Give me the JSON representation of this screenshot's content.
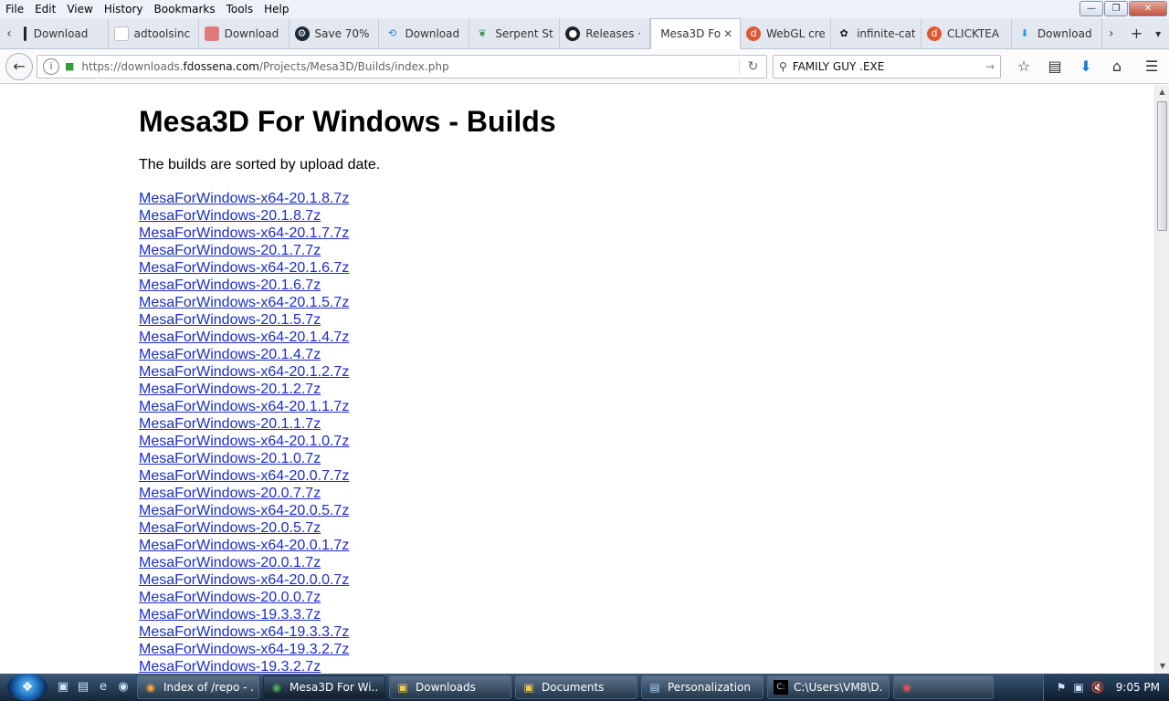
{
  "menubar": {
    "items": [
      "File",
      "Edit",
      "View",
      "History",
      "Bookmarks",
      "Tools",
      "Help"
    ]
  },
  "tabs": [
    {
      "label": "Download",
      "icon": "black-bar-icon"
    },
    {
      "label": "adtoolsinc",
      "icon": "blank-page-icon"
    },
    {
      "label": "Download",
      "icon": "red-box-icon"
    },
    {
      "label": "Save 70% o",
      "icon": "steam-icon"
    },
    {
      "label": "Download",
      "icon": "blue-swirl-icon"
    },
    {
      "label": "Serpent St",
      "icon": "serpent-icon"
    },
    {
      "label": "Releases ·",
      "icon": "github-icon"
    },
    {
      "label": "Mesa3D Fo",
      "icon": "none",
      "active": true
    },
    {
      "label": "WebGL cre",
      "icon": "duckduckgo-icon"
    },
    {
      "label": "infinite-cat",
      "icon": "paw-icon"
    },
    {
      "label": "CLICKTEA",
      "icon": "duckduckgo-icon"
    },
    {
      "label": "Download",
      "icon": "download-arrow-icon"
    }
  ],
  "navbar": {
    "url_prefix": "https://downloads.",
    "url_domain": "fdossena.com",
    "url_path": "/Projects/Mesa3D/Builds/index.php",
    "search_value": "FAMILY GUY .EXE"
  },
  "page": {
    "title": "Mesa3D For Windows - Builds",
    "subtitle": "The builds are sorted by upload date.",
    "links": [
      "MesaForWindows-x64-20.1.8.7z",
      "MesaForWindows-20.1.8.7z",
      "MesaForWindows-x64-20.1.7.7z",
      "MesaForWindows-20.1.7.7z",
      "MesaForWindows-x64-20.1.6.7z",
      "MesaForWindows-20.1.6.7z",
      "MesaForWindows-x64-20.1.5.7z",
      "MesaForWindows-20.1.5.7z",
      "MesaForWindows-x64-20.1.4.7z",
      "MesaForWindows-20.1.4.7z",
      "MesaForWindows-x64-20.1.2.7z",
      "MesaForWindows-20.1.2.7z",
      "MesaForWindows-x64-20.1.1.7z",
      "MesaForWindows-20.1.1.7z",
      "MesaForWindows-x64-20.1.0.7z",
      "MesaForWindows-20.1.0.7z",
      "MesaForWindows-x64-20.0.7.7z",
      "MesaForWindows-20.0.7.7z",
      "MesaForWindows-x64-20.0.5.7z",
      "MesaForWindows-20.0.5.7z",
      "MesaForWindows-x64-20.0.1.7z",
      "MesaForWindows-20.0.1.7z",
      "MesaForWindows-x64-20.0.0.7z",
      "MesaForWindows-20.0.0.7z",
      "MesaForWindows-19.3.3.7z",
      "MesaForWindows-x64-19.3.3.7z",
      "MesaForWindows-x64-19.3.2.7z",
      "MesaForWindows-19.3.2.7z"
    ]
  },
  "taskbar": {
    "buttons": [
      {
        "label": "Index of /repo - ...",
        "icon": "firefox-icon"
      },
      {
        "label": "Mesa3D For Wi...",
        "icon": "firefox-icon",
        "active": true
      },
      {
        "label": "Downloads",
        "icon": "folder-icon"
      },
      {
        "label": "Documents",
        "icon": "folder-icon"
      },
      {
        "label": "Personalization",
        "icon": "display-icon"
      },
      {
        "label": "C:\\Users\\VM8\\D...",
        "icon": "cmd-icon"
      },
      {
        "label": "",
        "icon": "media-icon"
      }
    ],
    "clock": "9:05 PM"
  },
  "colors": {
    "link": "#1a2ec8",
    "taskbar": "#1d3550"
  }
}
